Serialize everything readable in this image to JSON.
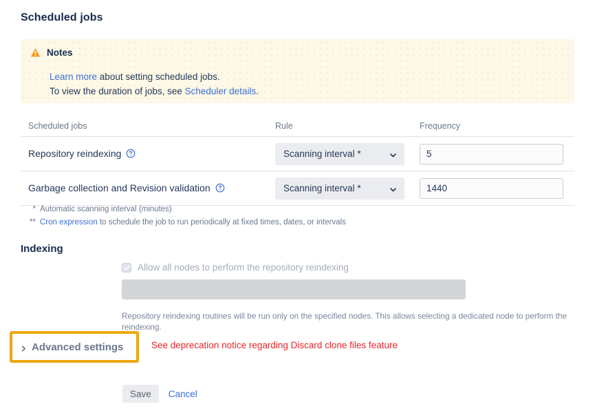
{
  "page": {
    "title": "Scheduled jobs"
  },
  "notes": {
    "icon": "warning-triangle-icon",
    "title": "Notes",
    "line1_link": "Learn more",
    "line1_rest": " about setting scheduled jobs.",
    "line2_prefix": "To view the duration of jobs, see ",
    "line2_link": "Scheduler details",
    "line2_suffix": "."
  },
  "jobs_table": {
    "headers": {
      "name": "Scheduled jobs",
      "rule": "Rule",
      "frequency": "Frequency"
    },
    "rows": [
      {
        "name": "Repository reindexing",
        "help_icon": "help-circle-icon",
        "rule": "Scanning interval *",
        "chevron_icon": "chevron-down-icon",
        "frequency": "5"
      },
      {
        "name": "Garbage collection and Revision validation",
        "help_icon": "help-circle-icon",
        "rule": "Scanning interval *",
        "chevron_icon": "chevron-down-icon",
        "frequency": "1440"
      }
    ]
  },
  "footnotes": [
    {
      "mark": "*",
      "text": "Automatic scanning interval (minutes)",
      "link": "",
      "rest": ""
    },
    {
      "mark": "**",
      "text": "",
      "link": "Cron expression",
      "rest": " to schedule the job to run periodically at fixed times, dates, or intervals"
    }
  ],
  "indexing": {
    "title": "Indexing",
    "checkbox_icon": "checkbox-checked-disabled-icon",
    "checkbox_label": "Allow all nodes to perform the repository reindexing",
    "node_field_value": "",
    "help_text": "Repository reindexing routines will be run only on the specified nodes. This allows selecting a dedicated node to perform the reindexing."
  },
  "advanced": {
    "chevron_icon": "chevron-right-icon",
    "label": "Advanced settings",
    "deprecation_notice": "See deprecation notice regarding Discard clone files feature"
  },
  "footer": {
    "save_label": "Save",
    "cancel_label": "Cancel"
  },
  "colors": {
    "notes_background": "#fdf8e7",
    "warning": "#f59a23",
    "link": "#3b6fd4",
    "highlight_border": "#eca610",
    "deprecation_text": "#e8262a",
    "heading": "#172b4d"
  }
}
